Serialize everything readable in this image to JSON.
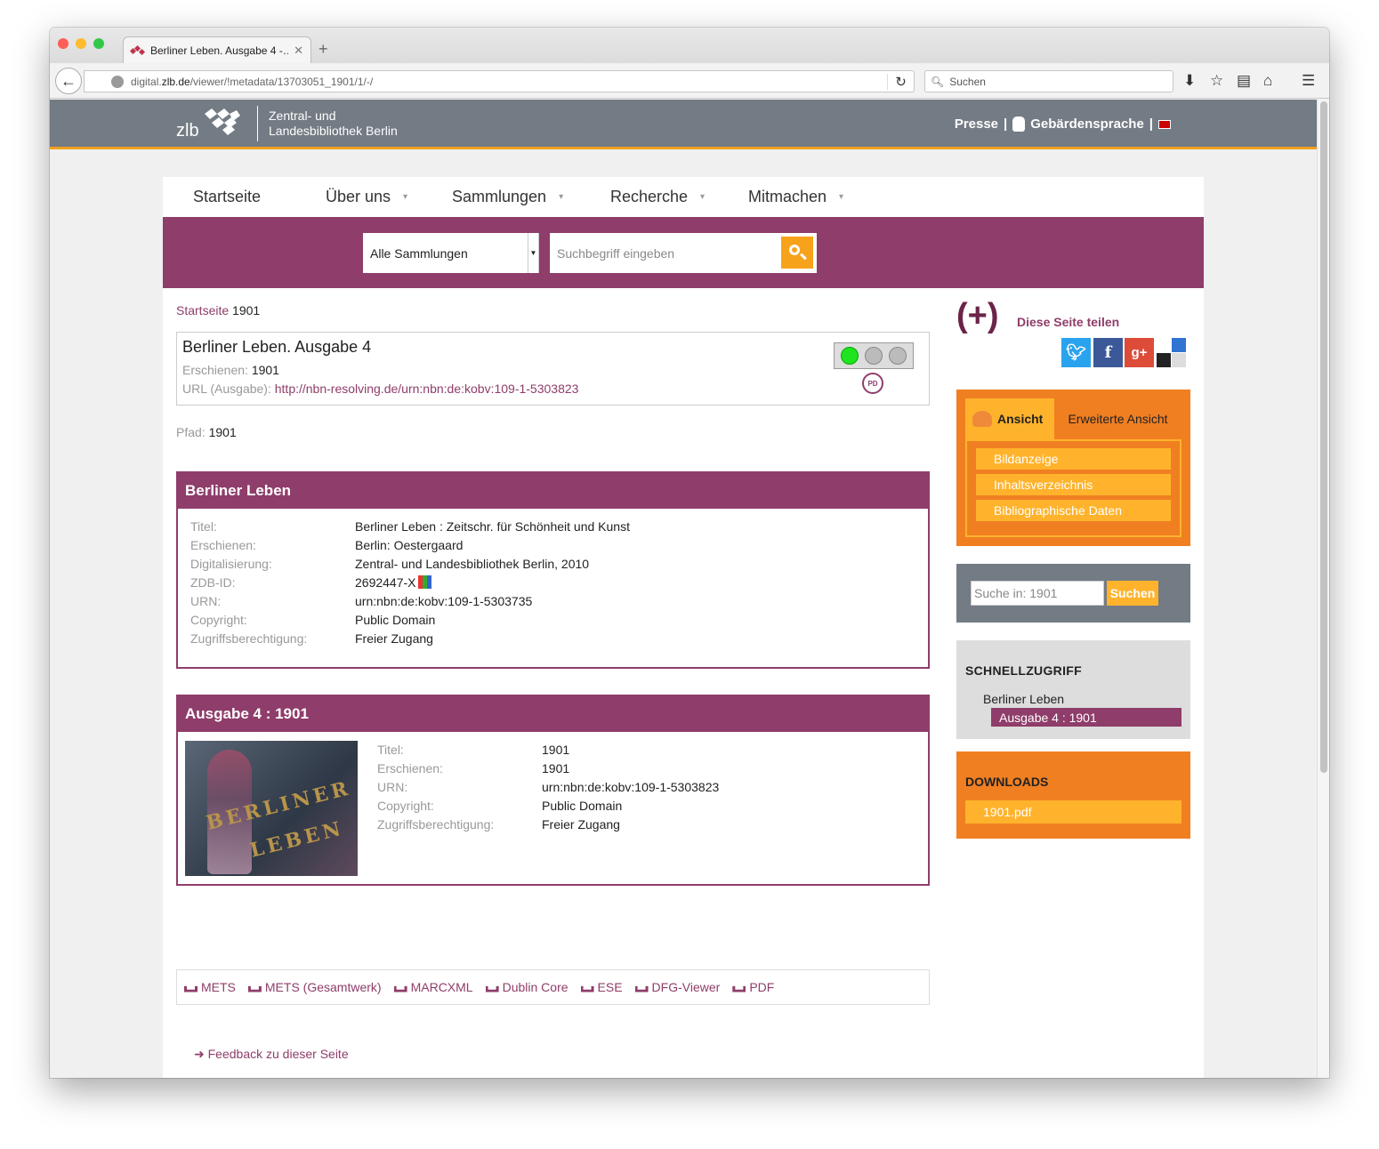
{
  "browser": {
    "tab_title": "Berliner Leben. Ausgabe 4 -…",
    "url_prefix": "digital.",
    "url_domain": "zlb.de",
    "url_path": "/viewer/!metadata/13703051_1901/1/-/",
    "search_placeholder": "Suchen"
  },
  "header": {
    "logo_text": "zlb",
    "name_line1": "Zentral- und",
    "name_line2": "Landesbibliothek Berlin",
    "presse": "Presse",
    "sep1": "|",
    "sign_language": "Gebärdensprache",
    "sep2": "|"
  },
  "nav": {
    "items": [
      {
        "label": "Startseite"
      },
      {
        "label": "Über uns"
      },
      {
        "label": "Sammlungen"
      },
      {
        "label": "Recherche"
      },
      {
        "label": "Mitmachen"
      }
    ]
  },
  "search": {
    "collection": "Alle Sammlungen",
    "placeholder": "Suchbegriff eingeben"
  },
  "breadcrumb": {
    "home": "Startseite",
    "current": "1901"
  },
  "record": {
    "title": "Berliner Leben. Ausgabe 4",
    "published_label": "Erschienen:",
    "published": "1901",
    "url_label": "URL (Ausgabe):",
    "url": "http://nbn-resolving.de/urn:nbn:de:kobv:109-1-5303823",
    "pd_badge": "PD"
  },
  "path": {
    "label": "Pfad:",
    "value": "1901"
  },
  "series_section": {
    "heading": "Berliner Leben",
    "rows": [
      {
        "k": "Titel:",
        "v": "Berliner Leben : Zeitschr. für Schönheit und Kunst"
      },
      {
        "k": "Erschienen:",
        "v": "Berlin: Oestergaard"
      },
      {
        "k": "Digitalisierung:",
        "v": "Zentral- und Landesbibliothek Berlin, 2010"
      },
      {
        "k": "ZDB-ID:",
        "v": "2692447-X"
      },
      {
        "k": "URN:",
        "v": "urn:nbn:de:kobv:109-1-5303735"
      },
      {
        "k": "Copyright:",
        "v": "Public Domain"
      },
      {
        "k": "Zugriffsberechtigung:",
        "v": "Freier Zugang"
      }
    ]
  },
  "issue_section": {
    "heading": "Ausgabe 4 : 1901",
    "thumb_text1": "BERLINER",
    "thumb_text2": "LEBEN",
    "rows": [
      {
        "k": "Titel:",
        "v": "1901"
      },
      {
        "k": "Erschienen:",
        "v": "1901"
      },
      {
        "k": "URN:",
        "v": "urn:nbn:de:kobv:109-1-5303823"
      },
      {
        "k": "Copyright:",
        "v": "Public Domain"
      },
      {
        "k": "Zugriffsberechtigung:",
        "v": "Freier Zugang"
      }
    ]
  },
  "exports": [
    {
      "label": "METS"
    },
    {
      "label": "METS (Gesamtwerk)"
    },
    {
      "label": "MARCXML"
    },
    {
      "label": "Dublin Core"
    },
    {
      "label": "ESE"
    },
    {
      "label": "DFG-Viewer"
    },
    {
      "label": "PDF"
    }
  ],
  "feedback": "➜ Feedback zu dieser Seite",
  "share": {
    "plus": "(+)",
    "label": "Diese Seite teilen"
  },
  "view_panel": {
    "tab_active": "Ansicht",
    "tab_other": "Erweiterte Ansicht",
    "items": [
      {
        "label": "Bildanzeige"
      },
      {
        "label": "Inhaltsverzeichnis"
      },
      {
        "label": "Bibliographische Daten"
      }
    ]
  },
  "inner_search": {
    "placeholder": "Suche in: 1901",
    "button": "Suchen"
  },
  "quick_access": {
    "heading": "SCHNELLZUGRIFF",
    "item1": "Berliner Leben",
    "item2": "Ausgabe 4 : 1901"
  },
  "downloads": {
    "heading": "DOWNLOADS",
    "file": "1901.pdf"
  },
  "colors": {
    "accent": "#8f3d6a",
    "orange": "#f07f22",
    "light_orange": "#ffb32c",
    "header_gray": "#737b84"
  }
}
